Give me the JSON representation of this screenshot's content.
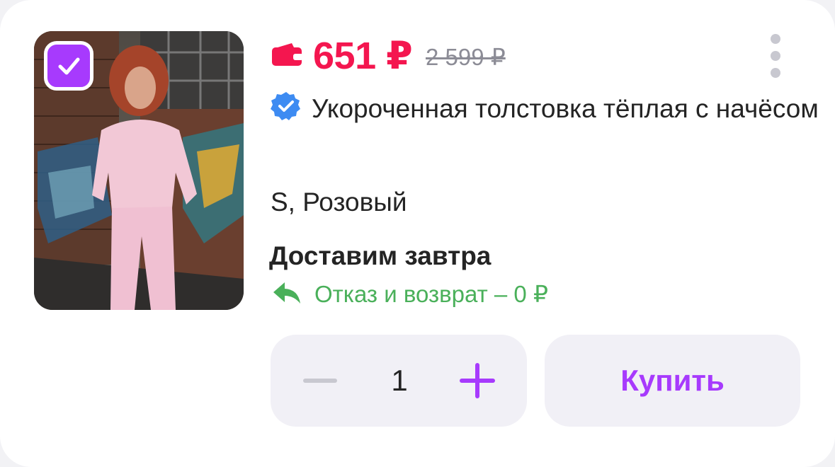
{
  "product": {
    "price": "651 ₽",
    "old_price": "2 599 ₽",
    "title": "Укороченная толстовка тёплая с начёсом",
    "variant": "S, Розовый",
    "delivery": "Доставим завтра",
    "return_policy": "Отказ и возврат – 0 ₽",
    "image_alt": "Женщина в розовом спортивном костюме на фоне кирпичной стены с граффити",
    "selected": true
  },
  "cart": {
    "quantity": "1",
    "buy_label": "Купить"
  },
  "icons": {
    "wallet": "wallet-icon",
    "verified": "verified-badge-icon",
    "more": "more-vertical-icon",
    "return": "return-arrow-icon",
    "minus": "minus-icon",
    "plus": "plus-icon",
    "check": "checkmark-icon"
  },
  "colors": {
    "accent": "#a73afd",
    "price": "#f4164f",
    "old_price": "#8c8c96",
    "return_green": "#4ab05a",
    "verified_blue": "#3d8bf2",
    "control_bg": "#f1f0f6"
  }
}
